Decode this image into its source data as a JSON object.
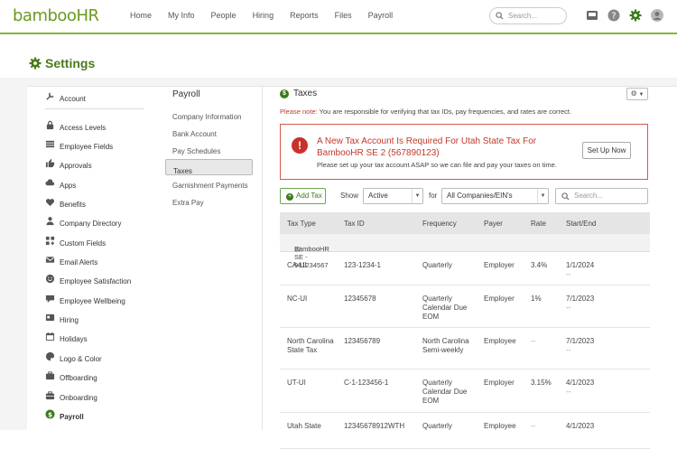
{
  "header": {
    "logo_text": "bambooHR",
    "nav": [
      "Home",
      "My Info",
      "People",
      "Hiring",
      "Reports",
      "Files",
      "Payroll"
    ],
    "search_placeholder": "Search..."
  },
  "page": {
    "title": "Settings"
  },
  "sidebar": {
    "items": [
      {
        "label": "Account",
        "icon": "wrench-icon"
      },
      {
        "label": "Access Levels",
        "icon": "lock-icon"
      },
      {
        "label": "Employee Fields",
        "icon": "list-icon"
      },
      {
        "label": "Approvals",
        "icon": "thumbs-up-icon"
      },
      {
        "label": "Apps",
        "icon": "cloud-icon"
      },
      {
        "label": "Benefits",
        "icon": "heart-icon"
      },
      {
        "label": "Company Directory",
        "icon": "person-icon"
      },
      {
        "label": "Custom Fields",
        "icon": "grid-plus-icon"
      },
      {
        "label": "Email Alerts",
        "icon": "mail-icon"
      },
      {
        "label": "Employee Satisfaction",
        "icon": "smile-icon"
      },
      {
        "label": "Employee Wellbeing",
        "icon": "chat-icon"
      },
      {
        "label": "Hiring",
        "icon": "id-card-icon"
      },
      {
        "label": "Holidays",
        "icon": "sun-icon"
      },
      {
        "label": "Logo & Color",
        "icon": "palette-icon"
      },
      {
        "label": "Offboarding",
        "icon": "briefcase-icon"
      },
      {
        "label": "Onboarding",
        "icon": "suitcase-icon"
      },
      {
        "label": "Payroll",
        "icon": "dollar-icon"
      }
    ]
  },
  "submenu": {
    "title": "Payroll",
    "items": [
      "Company Information",
      "Bank Account",
      "Pay Schedules",
      "Taxes",
      "Garnishment Payments",
      "Extra Pay"
    ],
    "selected": "Taxes"
  },
  "taxes": {
    "title": "Taxes",
    "note_label": "Please note:",
    "note_text": " You are responsible for verifying that tax IDs, pay frequencies, and rates are correct.",
    "alert": {
      "title": "A New Tax Account Is Required For Utah State Tax For BambooHR SE 2 (567890123)",
      "description": "Please set up your tax account ASAP so we can file and pay your taxes on time.",
      "button": "Set Up Now"
    },
    "filters": {
      "add_label": "Add Tax",
      "show_label": "Show",
      "show_value": "Active",
      "for_label": "for",
      "for_value": "All Companies/EIN's",
      "search_placeholder": "Search..."
    },
    "columns": [
      "Tax Type",
      "Tax ID",
      "Frequency",
      "Payer",
      "Rate",
      "Start/End"
    ],
    "group": "BambooHR SE - 981234567",
    "rows": [
      {
        "type": "CA-UI",
        "id": "123-1234-1",
        "freq": "Quarterly",
        "payer": "Employer",
        "rate": "3.4%",
        "start": "1/1/2024",
        "end": "--"
      },
      {
        "type": "NC-UI",
        "id": "12345678",
        "freq": "Quarterly Calendar Due EOM",
        "payer": "Employer",
        "rate": "1%",
        "start": "7/1/2023",
        "end": "--"
      },
      {
        "type": "North Carolina State Tax",
        "id": "123456789",
        "freq": "North Carolina Semi-weekly",
        "payer": "Employee",
        "rate": "--",
        "start": "7/1/2023",
        "end": "--"
      },
      {
        "type": "UT-UI",
        "id": "C-1-123456-1",
        "freq": "Quarterly Calendar Due EOM",
        "payer": "Employer",
        "rate": "3.15%",
        "start": "4/1/2023",
        "end": "--"
      },
      {
        "type": "Utah State",
        "id": "12345678912WTH",
        "freq": "Quarterly",
        "payer": "Employee",
        "rate": "--",
        "start": "4/1/2023",
        "end": ""
      }
    ]
  },
  "colors": {
    "brand": "#82b838",
    "title": "#4a7a1a",
    "alert": "#c0392b"
  }
}
